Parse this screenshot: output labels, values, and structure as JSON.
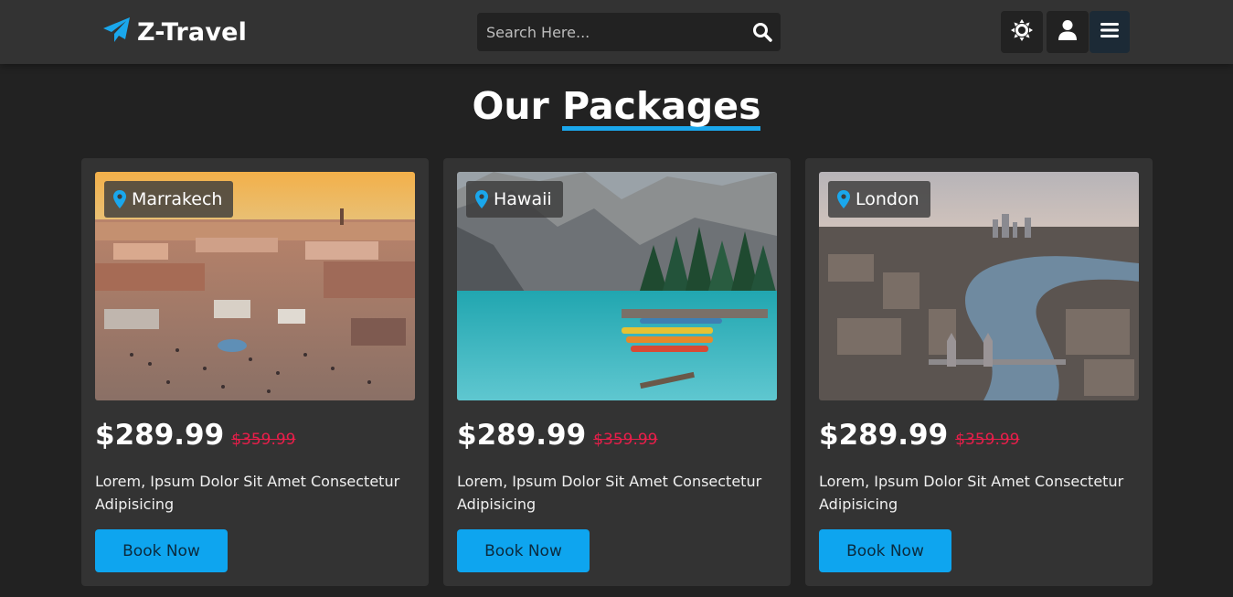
{
  "header": {
    "logo_text": "Z-Travel",
    "search_placeholder": "Search Here..."
  },
  "section": {
    "title_plain": "Our ",
    "title_accent": "Packages"
  },
  "packages": [
    {
      "location": "Marrakech",
      "price": "$289.99",
      "old_price": "$359.99",
      "description": "Lorem, Ipsum Dolor Sit Amet Consectetur Adipisicing",
      "button": "Book Now"
    },
    {
      "location": "Hawaii",
      "price": "$289.99",
      "old_price": "$359.99",
      "description": "Lorem, Ipsum Dolor Sit Amet Consectetur Adipisicing",
      "button": "Book Now"
    },
    {
      "location": "London",
      "price": "$289.99",
      "old_price": "$359.99",
      "description": "Lorem, Ipsum Dolor Sit Amet Consectetur Adipisicing",
      "button": "Book Now"
    }
  ],
  "colors": {
    "accent": "#1aa7ec",
    "old_price": "#e91e4a",
    "header_bg": "#333333",
    "page_bg": "#222222"
  },
  "icons": {
    "logo": "paper-plane-icon",
    "search": "search-icon",
    "theme": "sun-icon",
    "user": "user-icon",
    "menu": "menu-icon",
    "location": "map-marker-icon"
  }
}
